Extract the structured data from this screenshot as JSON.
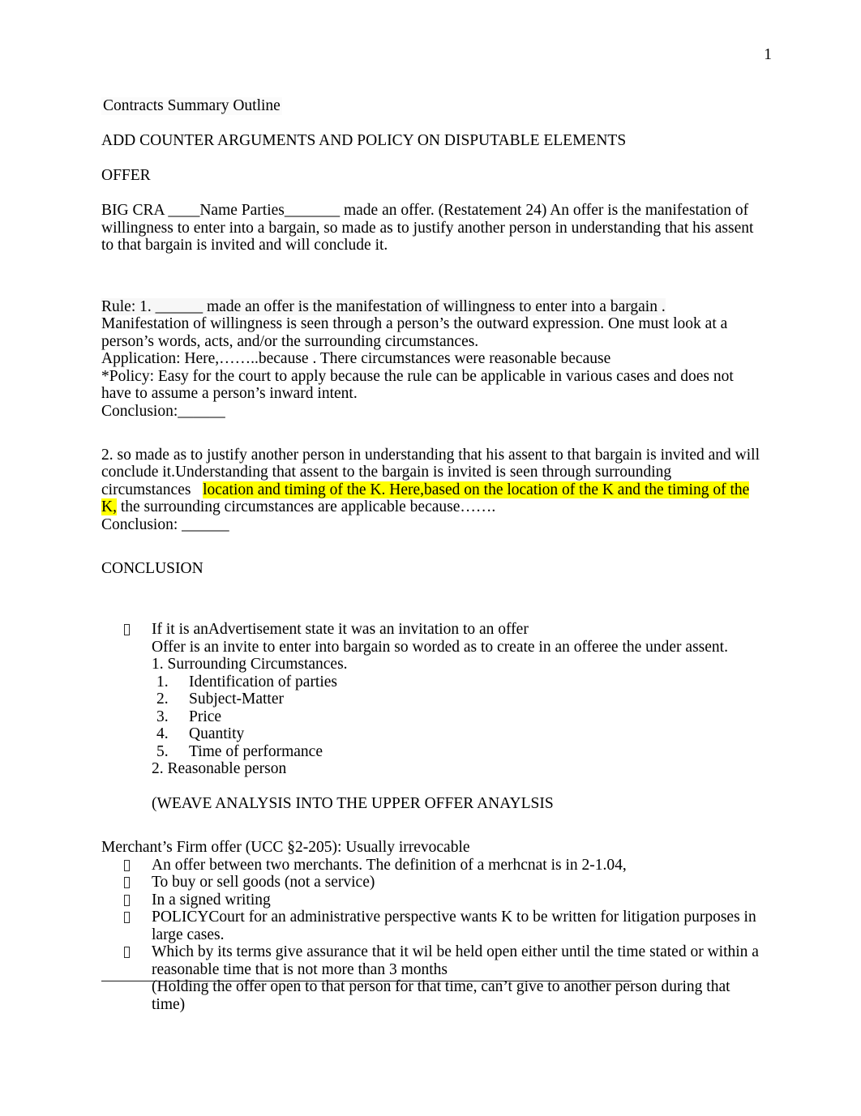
{
  "document": {
    "page_number": "1",
    "title": "Contracts Summary Outline",
    "heading_all_caps": "ADD COUNTER ARGUMENTS AND POLICY ON DISPUTABLE ELEMENTS",
    "section_heading": "OFFER"
  },
  "body": {
    "big_cra_paragraph": "BIG CRA ____Name Parties_______ made an offer. (Restatement 24) An offer is the manifestation of willingness to enter into a bargain, so made as to justify another person in understanding that his assent to that bargain is invited and will conclude it.",
    "rule_block": {
      "line1": "Rule: 1. ______ made an offer is the manifestation of willingness to enter into a bargain .",
      "line2": "Manifestation of willingness is seen through a person’s the outward expression. One must look at a person’s words, acts, and/or the surrounding circumstances.",
      "line3": "Application: Here,……..because . There circumstances were reasonable because",
      "line4": "*Policy: Easy for the court to apply because the rule can be applicable in various cases and does not have to assume a person’s inward intent.",
      "line5": "Conclusion:______"
    },
    "element_two_block": {
      "part_plain_1": "2. so made as to justify another person in understanding that his assent to that bargain is invited and will conclude it.",
      "part_plain_2": "Understanding that assent to the bargain is invited is seen through surrounding circumstances",
      "part_highlight_1": "location and timing of the K. Here,based on the location of the K and the timing of the K,",
      "part_plain_3": " the surrounding circumstances are applicable because…….",
      "conclusion": "Conclusion: ______"
    },
    "conclusion_heading": "CONCLUSION"
  },
  "advertisement_bullet": {
    "bullet_text": "If it is anAdvertisement  state it was an  invitation to an offer",
    "sub_line_1": "Offer is an invite to enter into bargain so worded as to create in an offeree the under assent.",
    "sub_line_2": "1. Surrounding Circumstances.",
    "numbered_items": [
      {
        "num": "1.",
        "label": "Identification of parties"
      },
      {
        "num": "2.",
        "label": "Subject-Matter"
      },
      {
        "num": "3.",
        "label": "Price"
      },
      {
        "num": "4.",
        "label": "Quantity"
      },
      {
        "num": "5.",
        "label": "Time of performance"
      }
    ],
    "sub_line_3": "2. Reasonable person",
    "weave_note": "(WEAVE ANALYSIS INTO THE UPPER OFFER ANAYLSIS"
  },
  "merchant_section": {
    "heading": "Merchant’s Firm offer  (UCC §2-205): Usually irrevocable",
    "bullets": [
      "An offer between two merchants. The definition of a merhcnat is in 2-1.04,",
      "To buy or sell goods (not a service)",
      "In a signed writing",
      "POLICYCourt for an administrative perspective wants K to be written for litigation purposes in large cases."
    ],
    "last_bullet": "Which by its terms give assurance that it wil be held open either until the time stated or within a reasonable time that is not more than 3 months",
    "last_bullet_note": "(Holding the offer open to that person for that time, can’t give to another person during that time)"
  },
  "colors": {
    "highlight": "#ffff00",
    "text": "#000000",
    "rule": "#1c1c1c"
  }
}
